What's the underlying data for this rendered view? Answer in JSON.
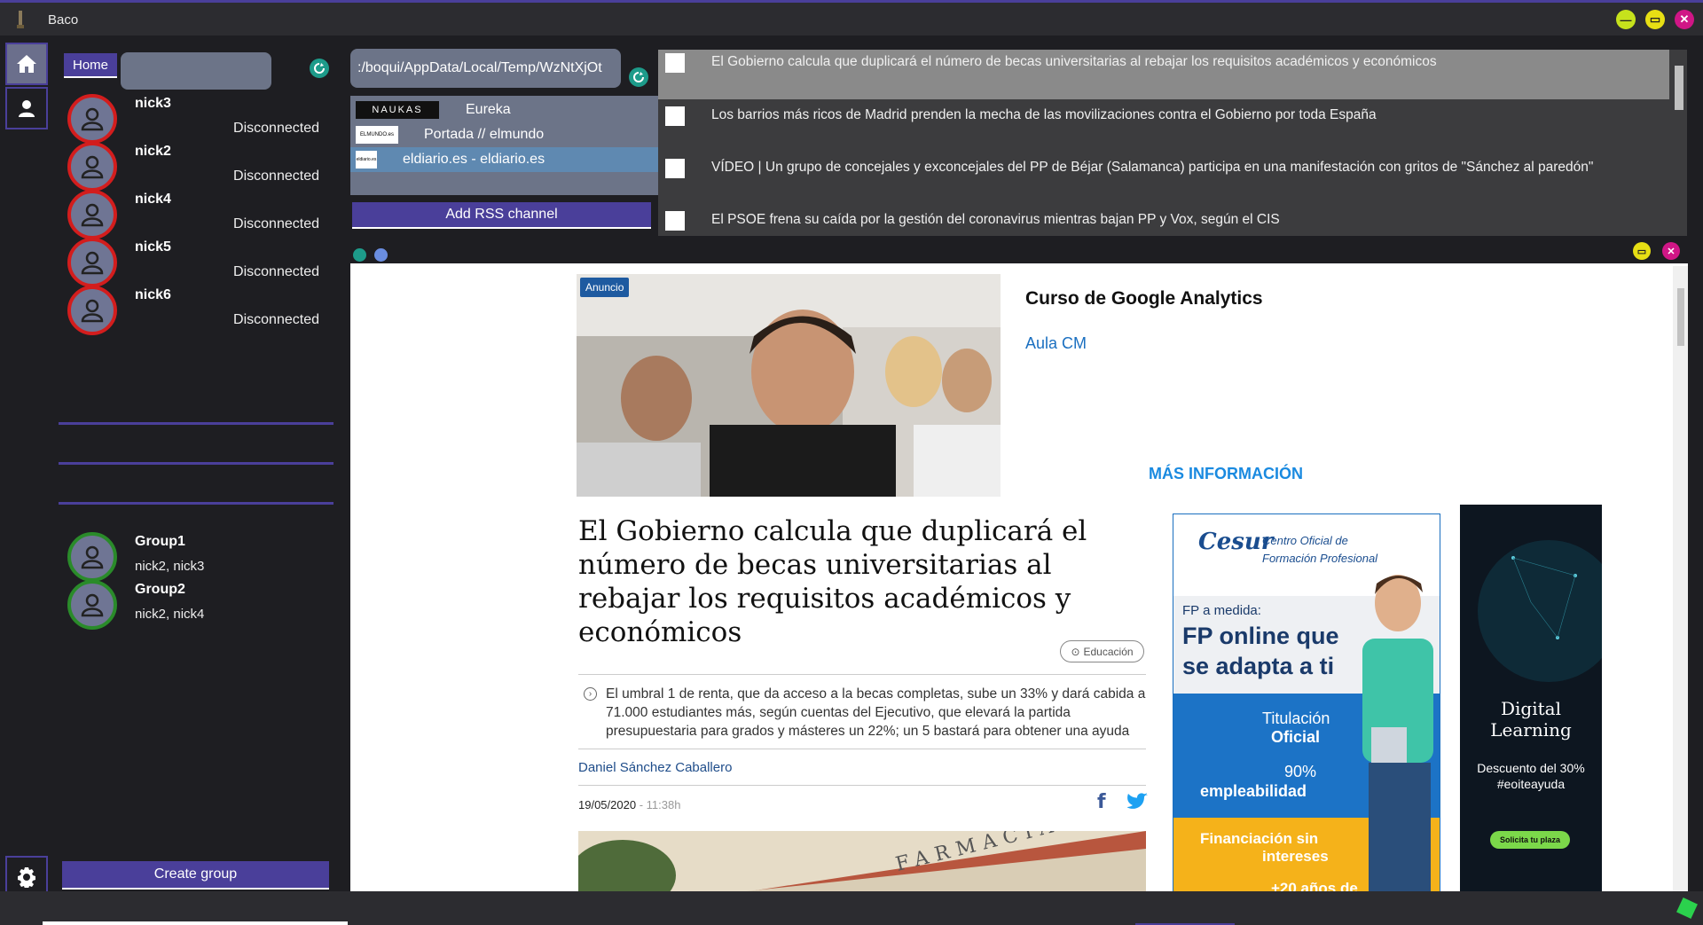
{
  "app": {
    "title": "Baco"
  },
  "window_controls": {
    "minimize": "—",
    "maximize": "▭",
    "close": "✕"
  },
  "sidenav": {
    "home_icon": "home-icon",
    "user_icon": "user-icon",
    "settings_icon": "gear-icon"
  },
  "contacts_panel": {
    "home_label": "Home",
    "search_value": "",
    "contacts": [
      {
        "name": "nick3",
        "status": "Disconnected"
      },
      {
        "name": "nick2",
        "status": "Disconnected"
      },
      {
        "name": "nick4",
        "status": "Disconnected"
      },
      {
        "name": "nick5",
        "status": "Disconnected"
      },
      {
        "name": "nick6",
        "status": "Disconnected"
      }
    ],
    "groups": [
      {
        "name": "Group1",
        "members": "nick2, nick3"
      },
      {
        "name": "Group2",
        "members": "nick2, nick4"
      }
    ],
    "create_group_label": "Create group"
  },
  "rss": {
    "path_value": ":/boqui/AppData/Local/Temp/WzNtXjOt",
    "channels": [
      {
        "logo": "NAUKAS",
        "name": "Eureka",
        "selected": false
      },
      {
        "logo": "ELMUNDO.es",
        "name": "Portada // elmundo",
        "selected": false
      },
      {
        "logo": "eldiario.es",
        "name": "eldiario.es - eldiario.es",
        "selected": true
      }
    ],
    "add_label": "Add RSS channel"
  },
  "news": [
    "El Gobierno calcula que duplicará el número de becas universitarias al rebajar los requisitos académicos y económicos",
    "Los barrios más ricos de Madrid prenden la mecha de las movilizaciones contra el Gobierno por toda España",
    "VÍDEO | Un grupo de concejales y exconcejales del PP de Béjar (Salamanca) participa en una manifestación con gritos de \"Sánchez al paredón\"",
    "El PSOE frena su caída por la gestión del coronavirus mientras bajan PP y Vox, según el CIS"
  ],
  "browser": {
    "ad": {
      "tag": "Anuncio",
      "title": "Curso de Google Analytics",
      "subtitle": "Aula CM",
      "more": "MÁS INFORMACIÓN"
    },
    "article": {
      "title": "El Gobierno calcula que duplicará el número de becas universitarias al rebajar los requisitos académicos y económicos",
      "tag": "Educación",
      "summary": "El umbral 1 de renta, que da acceso a la becas completas, sube un 33% y dará cabida a 71.000 estudiantes más, según cuentas del Ejecutivo, que elevará la partida presupuestaria para grados y másteres un 22%; un 5 bastará para obtener una ayuda",
      "author": "Daniel Sánchez Caballero",
      "date": "19/05/2020",
      "time": " - 11:38h",
      "photo_text": "FARMACIA"
    },
    "cesur": {
      "logo": "Cesur",
      "tagline1": "Centro Oficial de",
      "tagline2": "Formación Profesional",
      "fp_small": "FP a medida:",
      "fp_big1": "FP online que",
      "fp_big2": "se adapta a ti",
      "titulacion1": "Titulación",
      "titulacion2": "Oficial",
      "emp1": "90%",
      "emp2": "empleabilidad",
      "fin1": "Financiación sin",
      "fin2": "intereses",
      "extra": "+20 años de"
    },
    "side_ad": {
      "title": "Digital Learning",
      "text1": "Descuento del 30%",
      "text2": "#eoiteayuda",
      "button": "Solicita tu plaza"
    }
  },
  "colors": {
    "accent": "#4a3f9a",
    "panel": "#1e1e22",
    "teal": "#1d9b8a",
    "disconnected_ring": "#d31d1d",
    "group_ring": "#2a8b2a"
  }
}
